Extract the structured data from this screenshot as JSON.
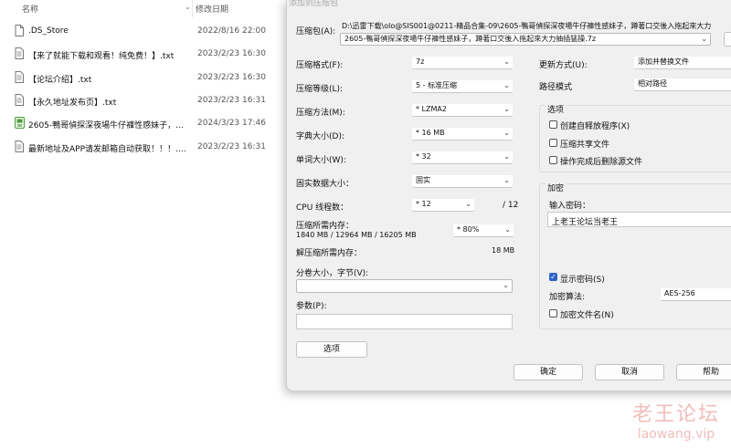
{
  "explorer": {
    "col_name": "名称",
    "col_date": "修改日期",
    "files": [
      {
        "name": ".DS_Store",
        "date": "2022/8/16 22:00",
        "icon": "blank-file-icon"
      },
      {
        "name": "【来了就能下载和观看！纯免费！】.txt",
        "date": "2023/2/23 16:30",
        "icon": "text-file-icon"
      },
      {
        "name": "【论坛介绍】.txt",
        "date": "2023/2/23 16:30",
        "icon": "text-file-icon"
      },
      {
        "name": "【永久地址发布页】.txt",
        "date": "2023/2/23 16:31",
        "icon": "text-file-icon"
      },
      {
        "name": "2605-鴨哥偵探深夜場牛仔褲性感妹子，蹲著口交後入拖起來大力抽插猛操.7z",
        "date": "2024/3/23 17:46",
        "icon": "archive-file-icon"
      },
      {
        "name": "最新地址及APP请发邮箱自动获取！！！.txt",
        "date": "2023/2/23 16:31",
        "icon": "text-file-icon"
      }
    ]
  },
  "dialog": {
    "title": "添加到压缩包",
    "archive_label": "压缩包(A):",
    "archive_path": "D:\\迅雷下载\\olo@SIS001@0211-精品合集-09\\2605-鴨哥偵探深夜場牛仔褲性感妹子，蹲著口交後入拖起來大力",
    "archive_name": "2605-鴨哥偵探深夜場牛仔褲性感妹子，蹲著口交後入拖起來大力抽插猛操.7z",
    "format_label": "压缩格式(F):",
    "format_value": "7z",
    "level_label": "压缩等级(L):",
    "level_value": "5 - 标准压缩",
    "method_label": "压缩方法(M):",
    "method_value": "* LZMA2",
    "dict_label": "字典大小(D):",
    "dict_value": "* 16 MB",
    "word_label": "单词大小(W):",
    "word_value": "* 32",
    "solid_label": "固实数据大小：",
    "solid_value": "固实",
    "cpu_label": "CPU 线程数：",
    "cpu_value": "* 12",
    "cpu_total": "/ 12",
    "mem_label": "压缩所需内存：",
    "mem_detail": "1840 MB / 12964 MB / 16205 MB",
    "mem_percent": "* 80%",
    "decomp_label": "解压缩所需内存：",
    "decomp_value": "18 MB",
    "split_label": "分卷大小，字节(V):",
    "split_value": "",
    "params_label": "参数(P):",
    "params_value": "",
    "options_button": "选项",
    "update_label": "更新方式(U):",
    "update_value": "添加并替换文件",
    "path_label": "路径模式",
    "path_value": "相对路径",
    "options_group": "选项",
    "opt_sfx": "创建自释放程序(X)",
    "opt_shared": "压缩共享文件",
    "opt_delete": "操作完成后删除源文件",
    "encrypt_group": "加密",
    "pwd_label": "输入密码：",
    "pwd_value": "上老王论坛当老王",
    "show_pwd": "显示密码(S)",
    "enc_method_label": "加密算法:",
    "enc_method_value": "AES-256",
    "enc_names": "加密文件名(N)",
    "ok": "确定",
    "cancel": "取消",
    "help": "帮助"
  },
  "watermark": {
    "line1": "老王论坛",
    "line2": "laowang.vip"
  },
  "colors": {
    "accent": "#2b63c8",
    "watermark": "#f2bcbc"
  }
}
